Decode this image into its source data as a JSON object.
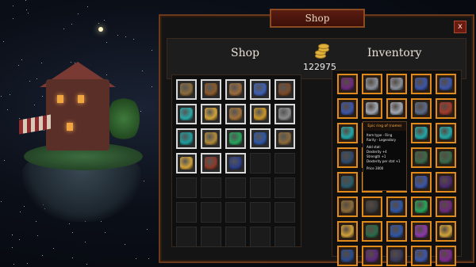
{
  "shop_window": {
    "title": "Shop",
    "close_label": "x",
    "shop_heading": "Shop",
    "inventory_heading": "Inventory",
    "gold_amount": "122975",
    "gold_icon": "coin-stack-icon"
  },
  "shop_grid": {
    "columns": 5,
    "rows": 7,
    "items": [
      {
        "name": "bow",
        "color": "#8b6b3a"
      },
      {
        "name": "leather-helmet",
        "color": "#8a5a2b"
      },
      {
        "name": "leather-gloves",
        "color": "#9b6a3b"
      },
      {
        "name": "blue-gauntlets",
        "color": "#3e5fb2"
      },
      {
        "name": "leather-armor",
        "color": "#7a4a27"
      },
      {
        "name": "amulet",
        "color": "#2aa6a6"
      },
      {
        "name": "gold-ring",
        "color": "#d1a23a"
      },
      {
        "name": "leather-gloves",
        "color": "#a0703a"
      },
      {
        "name": "golden-gauntlets",
        "color": "#c8952c"
      },
      {
        "name": "axe",
        "color": "#8a8a8a"
      },
      {
        "name": "teal-amulet",
        "color": "#1f9b9b"
      },
      {
        "name": "necklace",
        "color": "#b08a3a"
      },
      {
        "name": "emerald-ring",
        "color": "#26a35a"
      },
      {
        "name": "blue-boots",
        "color": "#2f55a3"
      },
      {
        "name": "bow",
        "color": "#8a6a3a"
      },
      {
        "name": "gold-ring",
        "color": "#d0a03a"
      },
      {
        "name": "chest-armor",
        "color": "#8a3a2a"
      },
      {
        "name": "blue-hood",
        "color": "#2c3e87"
      }
    ]
  },
  "inventory_grid": {
    "columns": 5,
    "rows": 8,
    "items": [
      {
        "name": "purple-hood",
        "color": "#6b2a7a"
      },
      {
        "name": "steel-helmet",
        "color": "#8a8f99"
      },
      {
        "name": "steel-helmet",
        "color": "#8a8f99"
      },
      {
        "name": "blue-armor",
        "color": "#3b55a8"
      },
      {
        "name": "blue-armor",
        "color": "#3b55a8"
      },
      {
        "name": "blue-gauntlets",
        "color": "#3b55a8"
      },
      {
        "name": "dagger",
        "color": "#9fa6b3"
      },
      {
        "name": "dagger",
        "color": "#9fa6b3"
      },
      {
        "name": "chain-armor",
        "color": "#5a6a88"
      },
      {
        "name": "red-dagger",
        "color": "#a23a2a"
      },
      {
        "name": "amulet",
        "color": "#23a6a6"
      },
      {
        "name": "cape",
        "color": "#5a3a7a"
      },
      {
        "name": "amulet",
        "color": "#23a6a6"
      },
      {
        "name": "amulet",
        "color": "#23a6a6"
      },
      {
        "name": "amulet",
        "color": "#23a6a6"
      },
      {
        "name": "leggings",
        "color": "#2d4a6a"
      },
      {
        "name": "chest-armor",
        "color": "#4a4a6a"
      },
      {
        "name": "chest-armor",
        "color": "#4a4a6a"
      },
      {
        "name": "leggings",
        "color": "#3a6a4a"
      },
      {
        "name": "leggings",
        "color": "#3a6a4a"
      },
      {
        "name": "leggings",
        "color": "#2a5a6a"
      },
      {
        "name": "chest-armor",
        "color": "#4a5a7a"
      },
      {
        "name": "blue-armor",
        "color": "#3b55a8"
      },
      {
        "name": "blue-armor",
        "color": "#3b55a8"
      },
      {
        "name": "cape",
        "color": "#4a2a6a"
      },
      {
        "name": "bow",
        "color": "#8b6b3a"
      },
      {
        "name": "boots",
        "color": "#3a3a3a"
      },
      {
        "name": "blue-boots",
        "color": "#2f55a3"
      },
      {
        "name": "emerald-ring",
        "color": "#26a35a"
      },
      {
        "name": "purple-hood",
        "color": "#6b2a7a"
      },
      {
        "name": "gold-ring",
        "color": "#d0a03a"
      },
      {
        "name": "leggings",
        "color": "#2a6a4a"
      },
      {
        "name": "blue-gloves",
        "color": "#2f55a3"
      },
      {
        "name": "purple-potion",
        "color": "#8a3aa8"
      },
      {
        "name": "amulet",
        "color": "#d1a23a"
      },
      {
        "name": "leggings",
        "color": "#2a4a8a"
      },
      {
        "name": "purple-hood",
        "color": "#5a2a7a"
      },
      {
        "name": "boots",
        "color": "#3a3a5a"
      },
      {
        "name": "blue-armor",
        "color": "#3b55a8"
      },
      {
        "name": "purple-robe",
        "color": "#7a2a8a"
      }
    ]
  },
  "tooltip": {
    "title": "Epic ring of (name)",
    "lines": [
      "Item type - Ring",
      "Rarity - Legendary"
    ],
    "stats_header": "Add stat:",
    "stats": [
      "Dexterity +4",
      "Strength +1",
      "Dexterity per stat +1"
    ],
    "price": "Price 3000"
  }
}
